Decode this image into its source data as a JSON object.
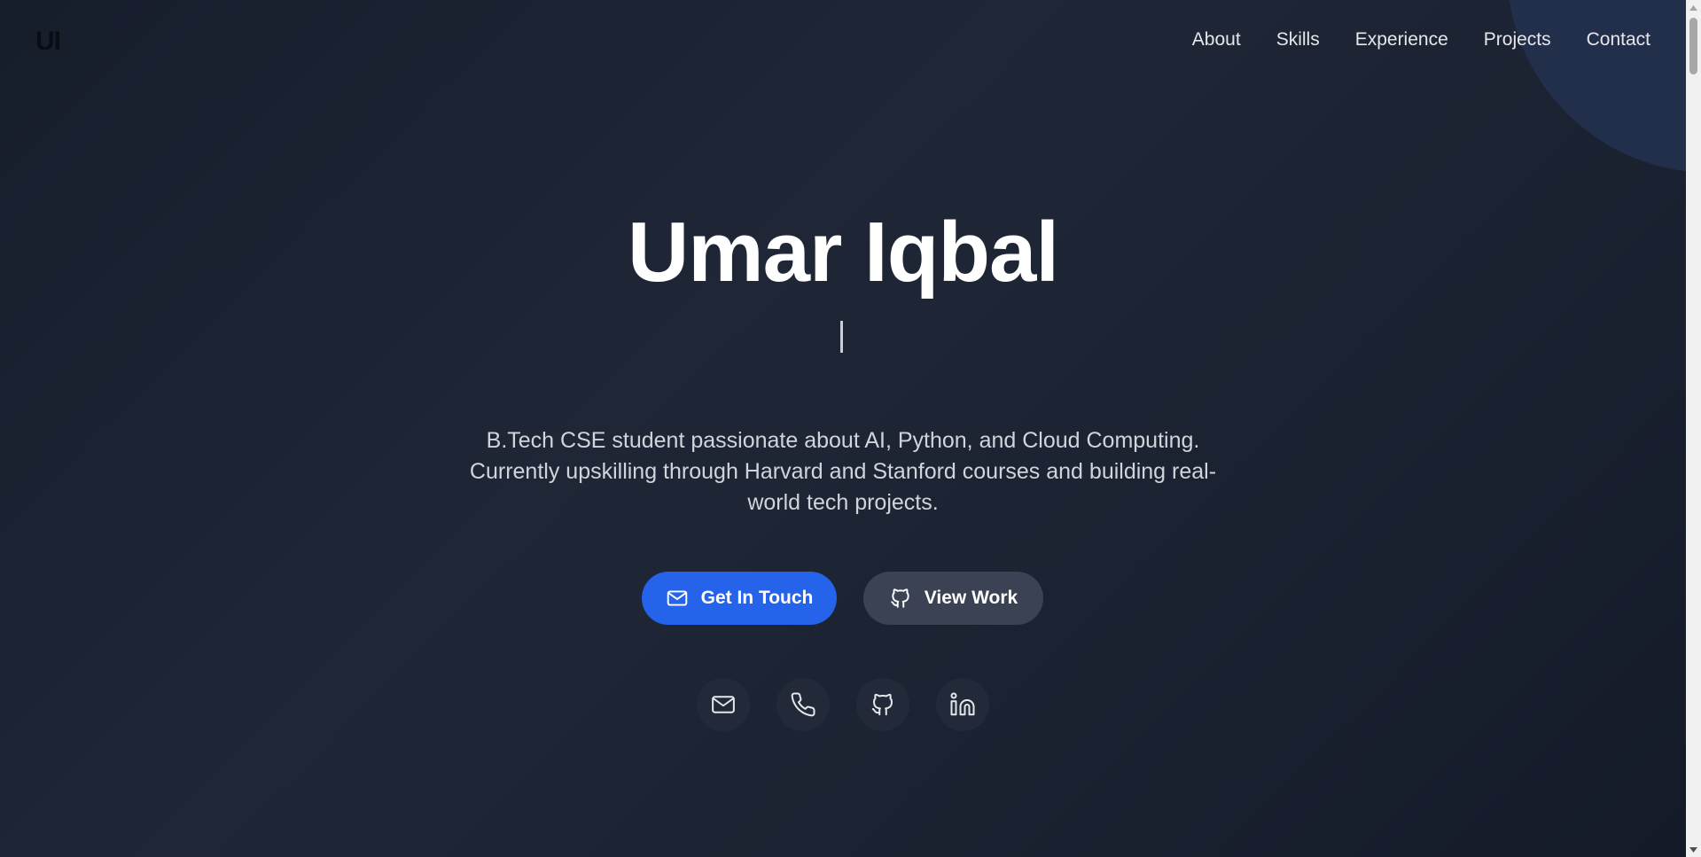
{
  "header": {
    "logo": "UI",
    "nav": [
      {
        "label": "About"
      },
      {
        "label": "Skills"
      },
      {
        "label": "Experience"
      },
      {
        "label": "Projects"
      },
      {
        "label": "Contact"
      }
    ]
  },
  "hero": {
    "name": "Umar Iqbal",
    "description_lines": [
      "B.Tech CSE student passionate about AI, Python, and Cloud Computing.",
      "Currently upskilling through Harvard and Stanford courses and building real-",
      "world tech projects."
    ],
    "primary_button": {
      "label": "Get In Touch",
      "icon": "mail-icon"
    },
    "secondary_button": {
      "label": "View Work",
      "icon": "github-icon"
    },
    "socials": [
      {
        "icon": "mail-icon"
      },
      {
        "icon": "phone-icon"
      },
      {
        "icon": "github-icon"
      },
      {
        "icon": "linkedin-icon"
      }
    ]
  },
  "colors": {
    "accent": "#2563eb",
    "secondary_button": "#3a4253",
    "background": "#1c2433"
  }
}
